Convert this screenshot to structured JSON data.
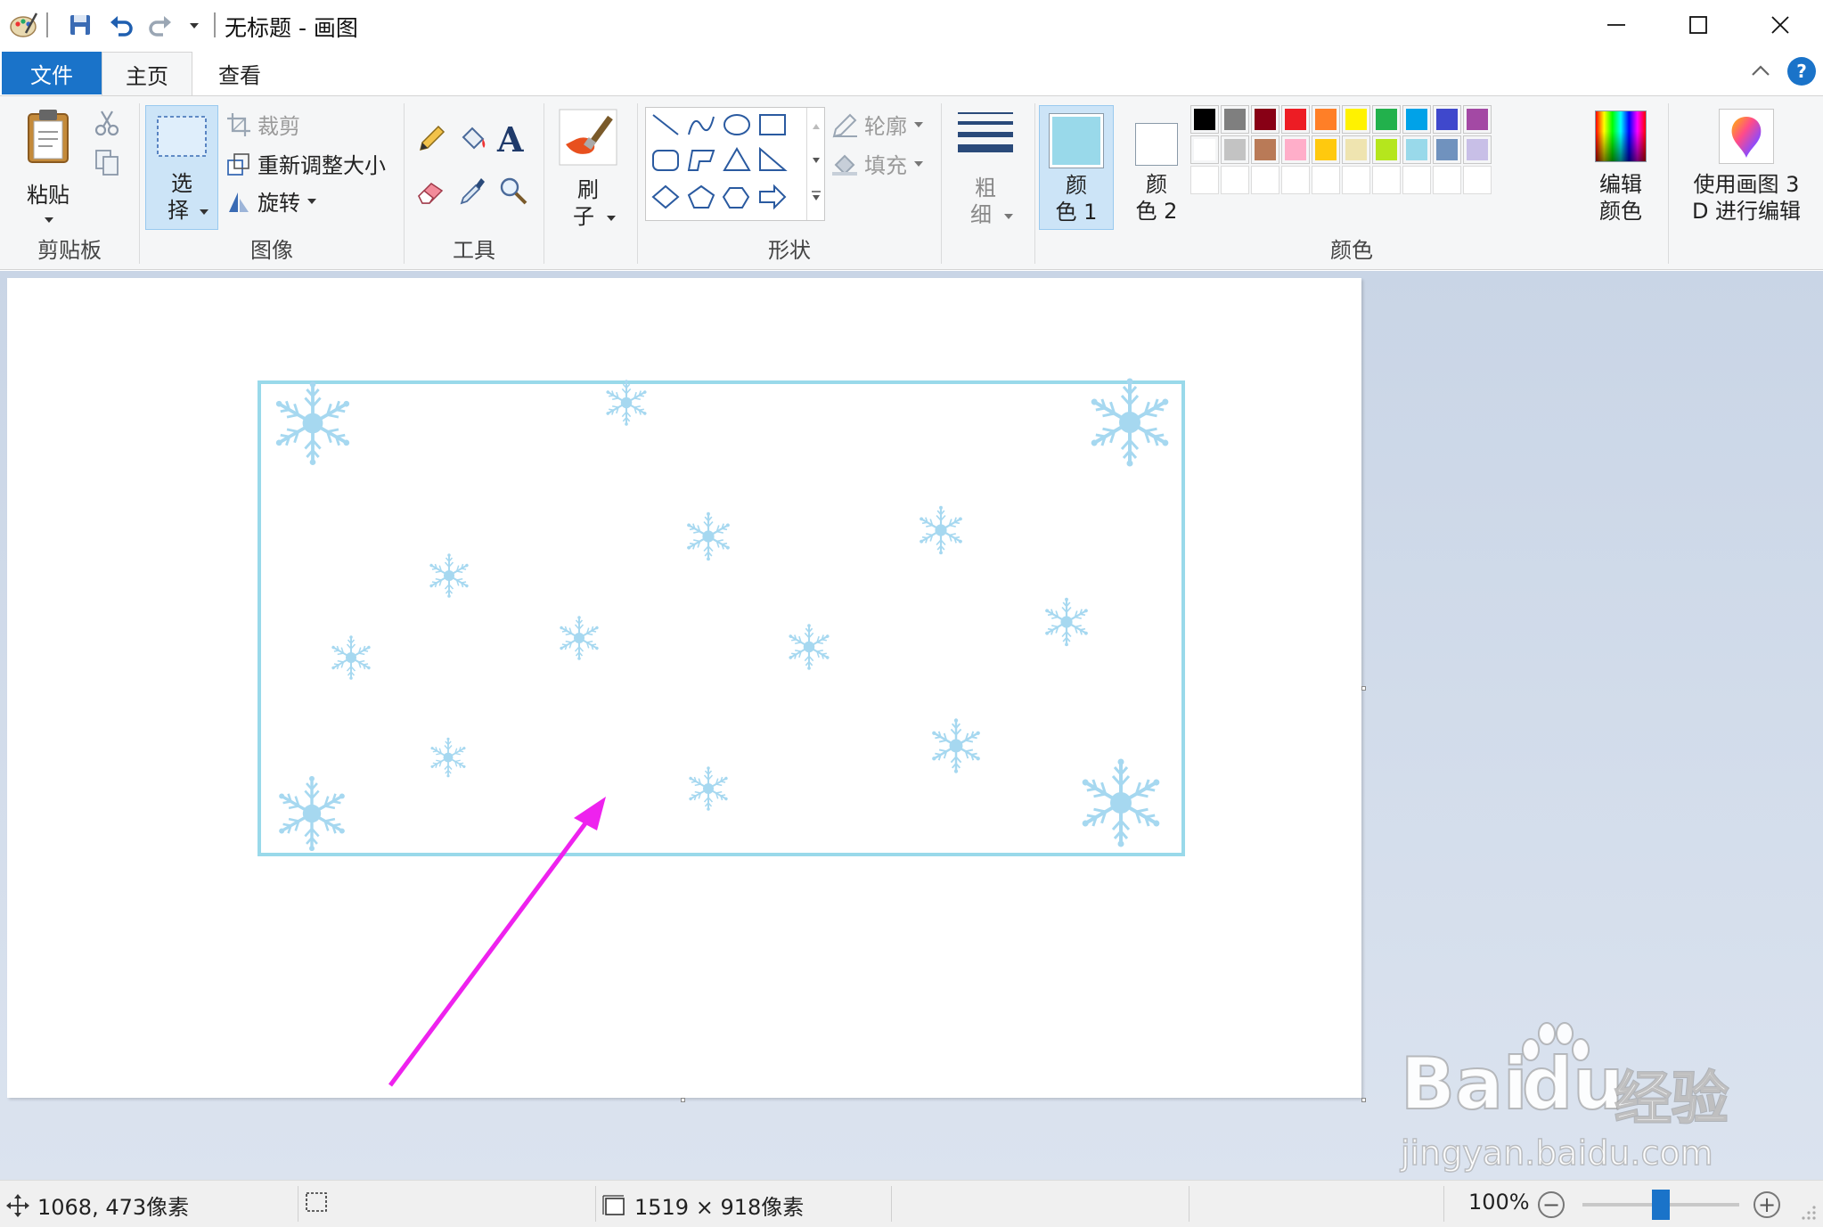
{
  "window": {
    "title": "无标题 - 画图",
    "minimize_glyph": "—",
    "maximize_glyph": "☐",
    "close_glyph": "✕"
  },
  "tabs": [
    {
      "label": "文件",
      "active": false
    },
    {
      "label": "主页",
      "active": true
    },
    {
      "label": "查看",
      "active": false
    }
  ],
  "ribbon": {
    "clipboard": {
      "paste_label": "粘贴",
      "group_label": "剪贴板"
    },
    "image": {
      "select_label_1": "选",
      "select_label_2": "择",
      "crop_label": "裁剪",
      "resize_label": "重新调整大小",
      "rotate_label": "旋转",
      "group_label": "图像"
    },
    "tools": {
      "group_label": "工具"
    },
    "brushes": {
      "label_1": "刷",
      "label_2": "子"
    },
    "shapes": {
      "outline_label": "轮廓",
      "fill_label": "填充",
      "group_label": "形状"
    },
    "size": {
      "label_1": "粗",
      "label_2": "细"
    },
    "colors": {
      "color1_label_1": "颜",
      "color1_label_2": "色 1",
      "color2_label_1": "颜",
      "color2_label_2": "色 2",
      "color1_value": "#99d9ea",
      "color2_value": "#ffffff",
      "edit_label_1": "编辑",
      "edit_label_2": "颜色",
      "group_label": "颜色",
      "palette_row1": [
        "#000000",
        "#7f7f7f",
        "#880015",
        "#ed1c24",
        "#ff7f27",
        "#fff200",
        "#22b14c",
        "#00a2e8",
        "#3f48cc",
        "#a349a4"
      ],
      "palette_row2": [
        "#ffffff",
        "#c3c3c3",
        "#b97a57",
        "#ffaec9",
        "#ffc90e",
        "#efe4b0",
        "#b5e61d",
        "#99d9ea",
        "#7092be",
        "#c8bfe7"
      ]
    },
    "paint3d": {
      "label_1": "使用画图 3",
      "label_2": "D 进行编辑"
    }
  },
  "canvas": {
    "frame_color": "#99d9ea",
    "snowflake_color": "#a6d8f0",
    "arrow_color": "#ee22ee"
  },
  "status": {
    "cursor_position": "1068, 473像素",
    "canvas_size": "1519 × 918像素",
    "zoom": "100%",
    "zoom_fraction": 0.5
  },
  "watermark": {
    "brand": "Bai",
    "brand2": "du",
    "brand_cn": "经验",
    "url": "jingyan.baidu.com"
  }
}
